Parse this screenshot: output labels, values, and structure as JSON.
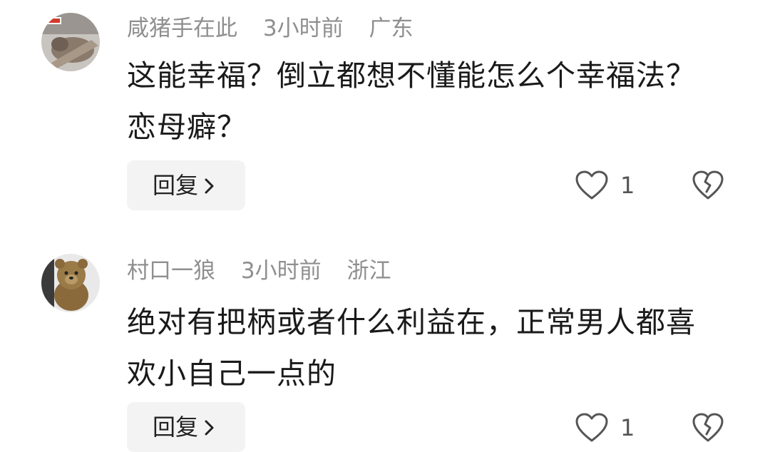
{
  "comments": [
    {
      "username": "咸猪手在此",
      "time": "3小时前",
      "location": "广东",
      "text": "这能幸福？倒立都想不懂能怎么个幸福法？恋母癖？",
      "reply_label": "回复",
      "likes": "1",
      "avatar_icon": "cat-photo-avatar"
    },
    {
      "username": "村口一狼",
      "time": "3小时前",
      "location": "浙江",
      "text": "绝对有把柄或者什么利益在，正常男人都喜欢小自己一点的",
      "reply_label": "回复",
      "likes": "1",
      "avatar_icon": "teddy-bear-avatar"
    }
  ],
  "icons": {
    "reply_chevron": "chevron-right-icon",
    "like": "heart-outline-icon",
    "dislike": "broken-heart-icon"
  },
  "colors": {
    "meta_text": "#8f8f8f",
    "body_text": "#1a1a1a",
    "reply_bg": "#f3f3f3"
  }
}
